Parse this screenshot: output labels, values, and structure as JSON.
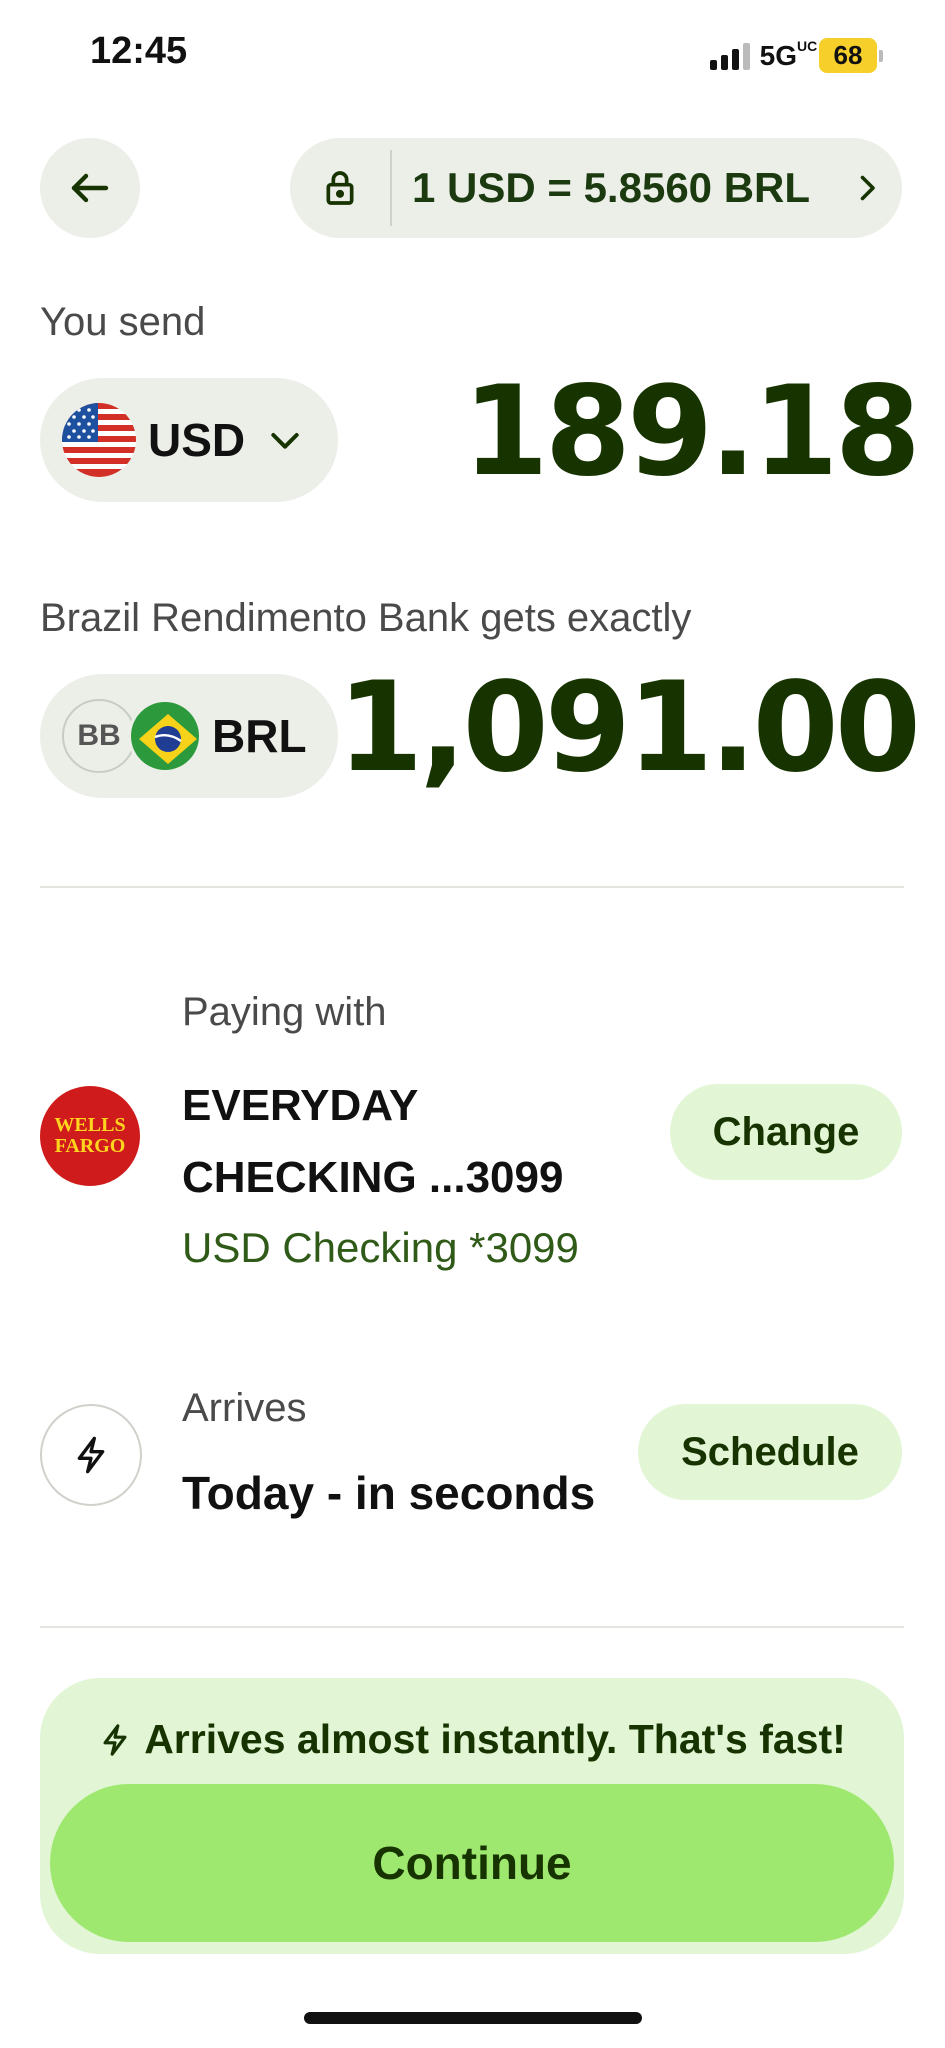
{
  "status_bar": {
    "time": "12:45",
    "network": "5G",
    "network_suffix": "UC",
    "battery": "68"
  },
  "header": {
    "back_icon": "arrow-left-icon",
    "lock_icon": "lock-icon",
    "rate_text": "1 USD = 5.8560 BRL",
    "chevron_icon": "chevron-right-icon"
  },
  "send": {
    "label": "You send",
    "currency": "USD",
    "flag_icon": "us-flag-icon",
    "dropdown_icon": "chevron-down-icon",
    "amount": "189.18"
  },
  "receive": {
    "label": "Brazil Rendimento Bank gets exactly",
    "bank_badge": "BB",
    "flag_icon": "brazil-flag-icon",
    "currency": "BRL",
    "amount": "1,091.00"
  },
  "payment": {
    "label": "Paying with",
    "bank_logo_line1": "WELLS",
    "bank_logo_line2": "FARGO",
    "account_name": "EVERYDAY CHECKING ...3099",
    "account_sub": "USD Checking *3099",
    "change_label": "Change"
  },
  "arrival": {
    "label": "Arrives",
    "value": "Today - in seconds",
    "schedule_label": "Schedule",
    "icon": "lightning-icon"
  },
  "footer": {
    "note": "Arrives almost instantly. That's fast!",
    "continue_label": "Continue"
  },
  "colors": {
    "brand_dark": "#163300",
    "brand_green": "#9fe870",
    "brand_light": "#e2f6d5",
    "pill_gray": "#eceee8",
    "bank_red": "#cf1b1b"
  }
}
